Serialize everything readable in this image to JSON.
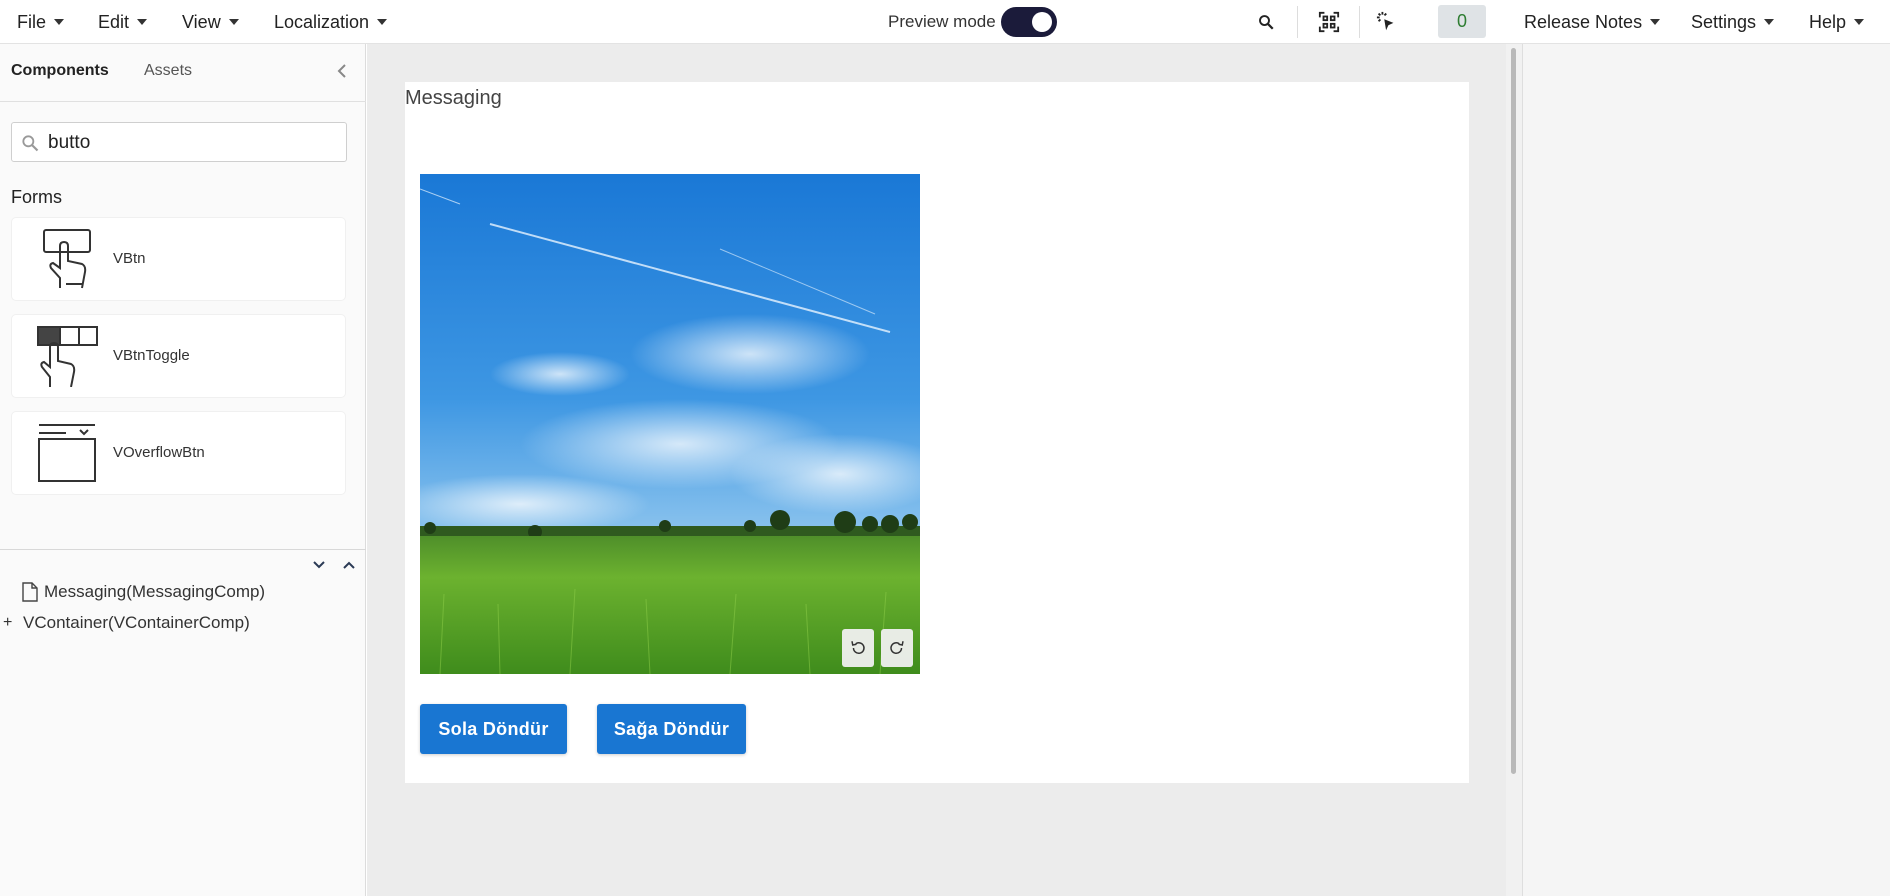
{
  "menu": {
    "file": "File",
    "edit": "Edit",
    "view": "View",
    "localization": "Localization",
    "release_notes": "Release Notes",
    "settings": "Settings",
    "help": "Help"
  },
  "toolbar": {
    "preview_label": "Preview mode",
    "preview_on": true,
    "counter": "0"
  },
  "left": {
    "tabs": [
      "Components",
      "Assets"
    ],
    "search_value": "butto",
    "section": "Forms",
    "components": [
      {
        "label": "VBtn",
        "icon": "button-hand-icon"
      },
      {
        "label": "VBtnToggle",
        "icon": "toggle-hand-icon"
      },
      {
        "label": "VOverflowBtn",
        "icon": "overflow-button-icon"
      }
    ],
    "tree": [
      {
        "label": "Messaging(MessagingComp)",
        "icon": "file-icon"
      },
      {
        "label": "VContainer(VContainerComp)",
        "icon": "plus-icon",
        "toggle": "+"
      }
    ]
  },
  "page": {
    "title": "Messaging",
    "image_alt": "Green field under blue sky",
    "buttons": [
      "Sola Döndür",
      "Sağa Döndür"
    ]
  },
  "colors": {
    "accent": "#1976d2",
    "toggle": "#1b1b3a",
    "counter_text": "#2e7d32"
  }
}
